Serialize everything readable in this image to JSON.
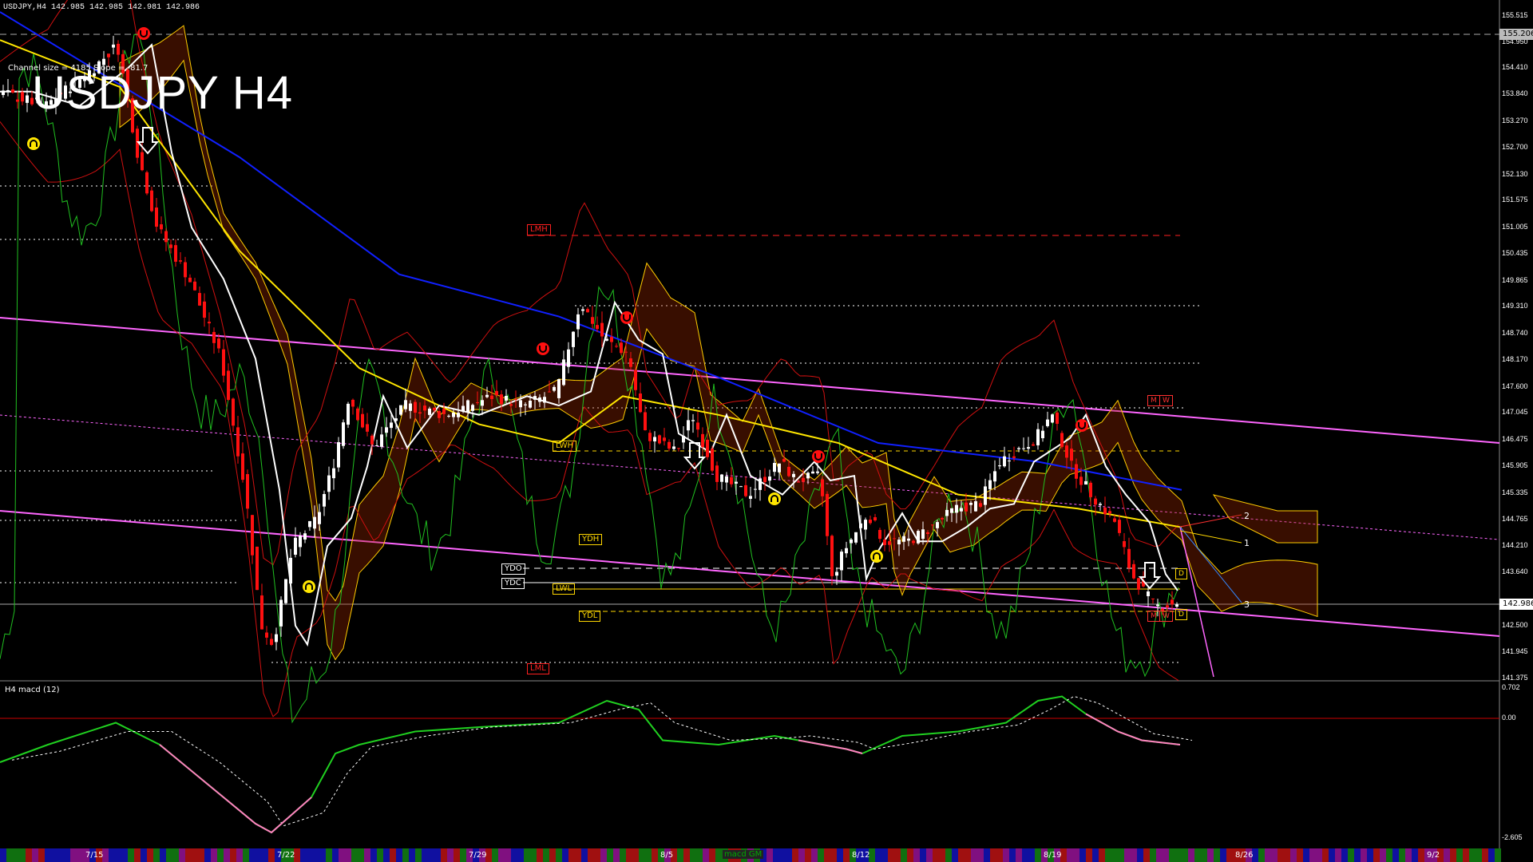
{
  "header": {
    "text": "USDJPY,H4 142.985 142.985 142.981 142.986"
  },
  "channel_note": "Channel size = 4185 Slope = -81.7",
  "symbol_title": "USDJPY H4",
  "indicator_label": "H4 macd (12)",
  "macd_button": "macd GM",
  "price_axis": [
    "155.515",
    "154.950",
    "154.410",
    "153.840",
    "153.270",
    "152.700",
    "152.130",
    "151.575",
    "151.005",
    "150.435",
    "149.865",
    "149.310",
    "148.740",
    "148.170",
    "147.600",
    "147.045",
    "146.475",
    "145.905",
    "145.335",
    "144.765",
    "144.210",
    "143.640",
    "142.500",
    "141.945",
    "141.375"
  ],
  "price_badges": {
    "top": "155.206",
    "current": "142.986"
  },
  "macd_axis": [
    "0.702",
    "0.00",
    "-2.605"
  ],
  "date_labels": [
    "7/15",
    "7/22",
    "7/29",
    "8/5",
    "8/12",
    "8/19",
    "8/26",
    "9/2"
  ],
  "level_tags": [
    {
      "text": "LMH",
      "color": "#ff2020"
    },
    {
      "text": "LWH",
      "color": "#ffd700"
    },
    {
      "text": "YDH",
      "color": "#ffd700"
    },
    {
      "text": "YDO",
      "color": "#ffffff"
    },
    {
      "text": "YDC",
      "color": "#ffffff"
    },
    {
      "text": "LWL",
      "color": "#ffd700"
    },
    {
      "text": "YDL",
      "color": "#ffd700"
    },
    {
      "text": "LML",
      "color": "#ff2020"
    }
  ],
  "right_tags": [
    "M",
    "W",
    "D",
    "M",
    "W",
    "D"
  ],
  "fan_labels": [
    "2",
    "1",
    "3"
  ],
  "colors": {
    "bull": "#ffffff",
    "bear": "#ff1010",
    "ema_white": "#ffffff",
    "ema_yellow": "#ffe600",
    "ema_blue": "#1020ff",
    "channel": "#ff66ff",
    "cloud": "#ffcc00",
    "bollinger": "#d01010",
    "rsi_green": "#20c020"
  }
}
